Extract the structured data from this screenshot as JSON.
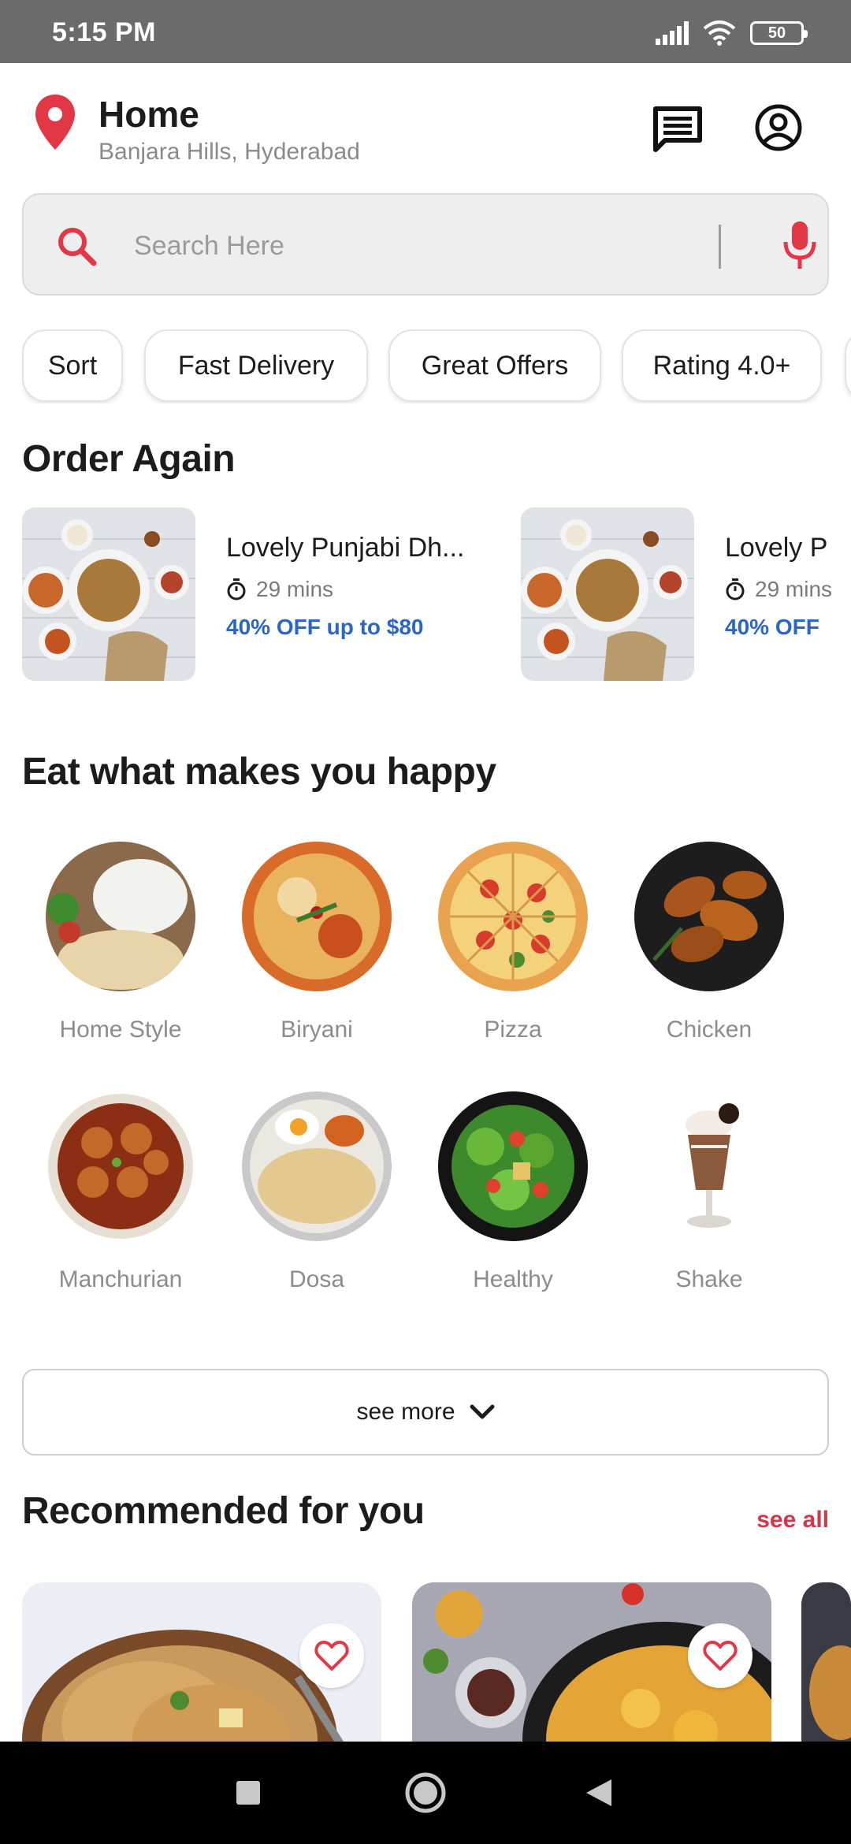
{
  "status_bar": {
    "time": "5:15 PM",
    "battery": "50"
  },
  "header": {
    "location_title": "Home",
    "location_subtitle": "Banjara Hills, Hyderabad",
    "location_icon": "map-pin-icon",
    "message_icon": "message-icon",
    "profile_icon": "profile-icon"
  },
  "search": {
    "placeholder": "Search Here",
    "search_icon": "search-icon",
    "mic_icon": "microphone-icon"
  },
  "filters": [
    "Sort",
    "Fast Delivery",
    "Great Offers",
    "Rating 4.0+"
  ],
  "order_again": {
    "title": "Order Again",
    "items": [
      {
        "name": "Lovely Punjabi Dh...",
        "time": "29 mins",
        "offer": "40% OFF up to $80"
      },
      {
        "name": "Lovely P",
        "time": "29 mins",
        "offer": "40% OFF"
      }
    ]
  },
  "categories": {
    "title": "Eat what makes you happy",
    "items": [
      "Home Style",
      "Biryani",
      "Pizza",
      "Chicken",
      "Manchurian",
      "Dosa",
      "Healthy",
      "Shake"
    ]
  },
  "see_more": "see more",
  "recommended": {
    "title": "Recommended for you",
    "see_all": "see all"
  },
  "colors": {
    "accent": "#d6354a",
    "offer_blue": "#2a66c9",
    "status_bar": "#6b6b6b"
  }
}
